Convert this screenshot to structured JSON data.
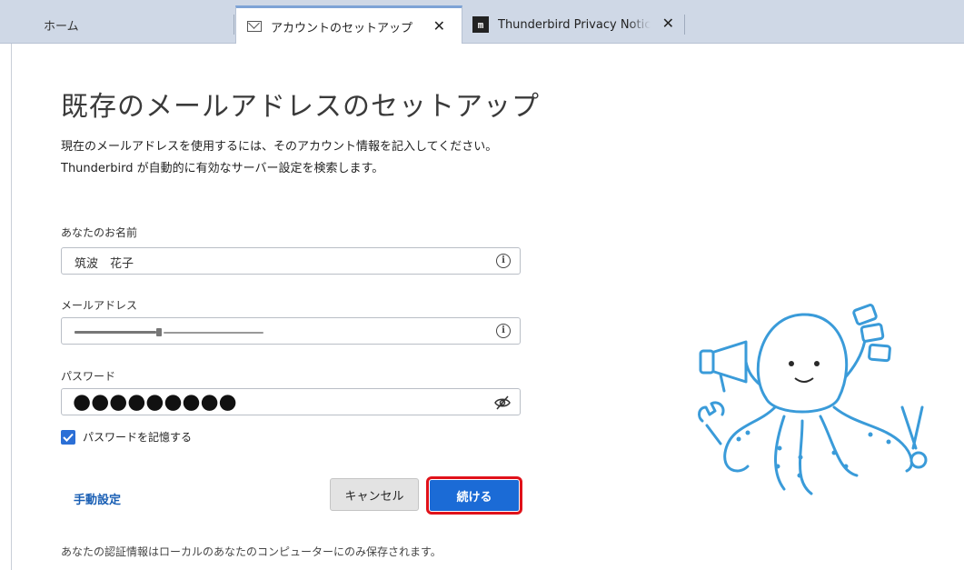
{
  "tabs": [
    {
      "label": "ホーム",
      "icon": "none",
      "closable": false,
      "active": false
    },
    {
      "label": "アカウントのセットアップ",
      "icon": "mail-icon",
      "closable": true,
      "active": true
    },
    {
      "label": "Thunderbird Privacy Notice",
      "icon": "m-logo-icon",
      "closable": true,
      "active": false
    }
  ],
  "page": {
    "title": "既存のメールアドレスのセットアップ",
    "intro_line1": "現在のメールアドレスを使用するには、そのアカウント情報を記入してください。",
    "intro_line2": "Thunderbird が自動的に有効なサーバー設定を検索します。"
  },
  "form": {
    "name_label": "あなたのお名前",
    "name_value": "筑波　花子",
    "email_label": "メールアドレス",
    "email_value_redacted": true,
    "password_label": "パスワード",
    "password_masked": "●●●●●●●●●",
    "remember_label": "パスワードを記憶する",
    "remember_checked": true
  },
  "actions": {
    "manual_config": "手動設定",
    "cancel": "キャンセル",
    "continue": "続ける",
    "continue_highlight_color": "#e0121a"
  },
  "footer": {
    "note": "あなたの認証情報はローカルのあなたのコンピューターにのみ保存されます。"
  },
  "colors": {
    "accent": "#1b6bd6",
    "tabbar": "#cfd8e6",
    "mascot": "#3a9bd9"
  }
}
